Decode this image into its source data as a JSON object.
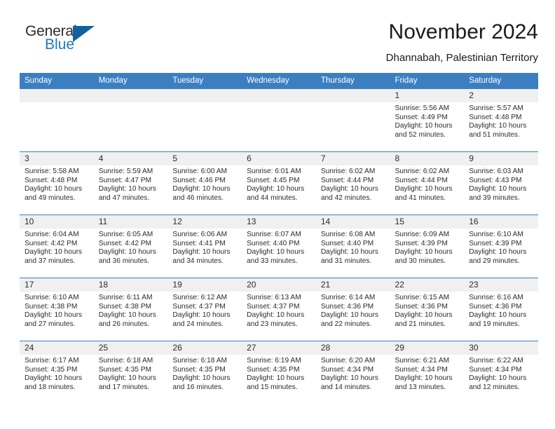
{
  "logo": {
    "word_one": "General",
    "word_two": "Blue",
    "icon": "triangle-logo-mark"
  },
  "header": {
    "month_title": "November 2024",
    "location": "Dhannabah, Palestinian Territory"
  },
  "calendar": {
    "weekday_headers": [
      "Sunday",
      "Monday",
      "Tuesday",
      "Wednesday",
      "Thursday",
      "Friday",
      "Saturday"
    ],
    "accent_color": "#3c7fc1",
    "daynum_band_color": "#f0f0f0",
    "weeks": [
      [
        {
          "day": "",
          "empty": true
        },
        {
          "day": "",
          "empty": true
        },
        {
          "day": "",
          "empty": true
        },
        {
          "day": "",
          "empty": true
        },
        {
          "day": "",
          "empty": true
        },
        {
          "day": "1",
          "sunrise": "Sunrise: 5:56 AM",
          "sunset": "Sunset: 4:49 PM",
          "daylight_line1": "Daylight: 10 hours",
          "daylight_line2": "and 52 minutes."
        },
        {
          "day": "2",
          "sunrise": "Sunrise: 5:57 AM",
          "sunset": "Sunset: 4:48 PM",
          "daylight_line1": "Daylight: 10 hours",
          "daylight_line2": "and 51 minutes."
        }
      ],
      [
        {
          "day": "3",
          "sunrise": "Sunrise: 5:58 AM",
          "sunset": "Sunset: 4:48 PM",
          "daylight_line1": "Daylight: 10 hours",
          "daylight_line2": "and 49 minutes."
        },
        {
          "day": "4",
          "sunrise": "Sunrise: 5:59 AM",
          "sunset": "Sunset: 4:47 PM",
          "daylight_line1": "Daylight: 10 hours",
          "daylight_line2": "and 47 minutes."
        },
        {
          "day": "5",
          "sunrise": "Sunrise: 6:00 AM",
          "sunset": "Sunset: 4:46 PM",
          "daylight_line1": "Daylight: 10 hours",
          "daylight_line2": "and 46 minutes."
        },
        {
          "day": "6",
          "sunrise": "Sunrise: 6:01 AM",
          "sunset": "Sunset: 4:45 PM",
          "daylight_line1": "Daylight: 10 hours",
          "daylight_line2": "and 44 minutes."
        },
        {
          "day": "7",
          "sunrise": "Sunrise: 6:02 AM",
          "sunset": "Sunset: 4:44 PM",
          "daylight_line1": "Daylight: 10 hours",
          "daylight_line2": "and 42 minutes."
        },
        {
          "day": "8",
          "sunrise": "Sunrise: 6:02 AM",
          "sunset": "Sunset: 4:44 PM",
          "daylight_line1": "Daylight: 10 hours",
          "daylight_line2": "and 41 minutes."
        },
        {
          "day": "9",
          "sunrise": "Sunrise: 6:03 AM",
          "sunset": "Sunset: 4:43 PM",
          "daylight_line1": "Daylight: 10 hours",
          "daylight_line2": "and 39 minutes."
        }
      ],
      [
        {
          "day": "10",
          "sunrise": "Sunrise: 6:04 AM",
          "sunset": "Sunset: 4:42 PM",
          "daylight_line1": "Daylight: 10 hours",
          "daylight_line2": "and 37 minutes."
        },
        {
          "day": "11",
          "sunrise": "Sunrise: 6:05 AM",
          "sunset": "Sunset: 4:42 PM",
          "daylight_line1": "Daylight: 10 hours",
          "daylight_line2": "and 36 minutes."
        },
        {
          "day": "12",
          "sunrise": "Sunrise: 6:06 AM",
          "sunset": "Sunset: 4:41 PM",
          "daylight_line1": "Daylight: 10 hours",
          "daylight_line2": "and 34 minutes."
        },
        {
          "day": "13",
          "sunrise": "Sunrise: 6:07 AM",
          "sunset": "Sunset: 4:40 PM",
          "daylight_line1": "Daylight: 10 hours",
          "daylight_line2": "and 33 minutes."
        },
        {
          "day": "14",
          "sunrise": "Sunrise: 6:08 AM",
          "sunset": "Sunset: 4:40 PM",
          "daylight_line1": "Daylight: 10 hours",
          "daylight_line2": "and 31 minutes."
        },
        {
          "day": "15",
          "sunrise": "Sunrise: 6:09 AM",
          "sunset": "Sunset: 4:39 PM",
          "daylight_line1": "Daylight: 10 hours",
          "daylight_line2": "and 30 minutes."
        },
        {
          "day": "16",
          "sunrise": "Sunrise: 6:10 AM",
          "sunset": "Sunset: 4:39 PM",
          "daylight_line1": "Daylight: 10 hours",
          "daylight_line2": "and 29 minutes."
        }
      ],
      [
        {
          "day": "17",
          "sunrise": "Sunrise: 6:10 AM",
          "sunset": "Sunset: 4:38 PM",
          "daylight_line1": "Daylight: 10 hours",
          "daylight_line2": "and 27 minutes."
        },
        {
          "day": "18",
          "sunrise": "Sunrise: 6:11 AM",
          "sunset": "Sunset: 4:38 PM",
          "daylight_line1": "Daylight: 10 hours",
          "daylight_line2": "and 26 minutes."
        },
        {
          "day": "19",
          "sunrise": "Sunrise: 6:12 AM",
          "sunset": "Sunset: 4:37 PM",
          "daylight_line1": "Daylight: 10 hours",
          "daylight_line2": "and 24 minutes."
        },
        {
          "day": "20",
          "sunrise": "Sunrise: 6:13 AM",
          "sunset": "Sunset: 4:37 PM",
          "daylight_line1": "Daylight: 10 hours",
          "daylight_line2": "and 23 minutes."
        },
        {
          "day": "21",
          "sunrise": "Sunrise: 6:14 AM",
          "sunset": "Sunset: 4:36 PM",
          "daylight_line1": "Daylight: 10 hours",
          "daylight_line2": "and 22 minutes."
        },
        {
          "day": "22",
          "sunrise": "Sunrise: 6:15 AM",
          "sunset": "Sunset: 4:36 PM",
          "daylight_line1": "Daylight: 10 hours",
          "daylight_line2": "and 21 minutes."
        },
        {
          "day": "23",
          "sunrise": "Sunrise: 6:16 AM",
          "sunset": "Sunset: 4:36 PM",
          "daylight_line1": "Daylight: 10 hours",
          "daylight_line2": "and 19 minutes."
        }
      ],
      [
        {
          "day": "24",
          "sunrise": "Sunrise: 6:17 AM",
          "sunset": "Sunset: 4:35 PM",
          "daylight_line1": "Daylight: 10 hours",
          "daylight_line2": "and 18 minutes."
        },
        {
          "day": "25",
          "sunrise": "Sunrise: 6:18 AM",
          "sunset": "Sunset: 4:35 PM",
          "daylight_line1": "Daylight: 10 hours",
          "daylight_line2": "and 17 minutes."
        },
        {
          "day": "26",
          "sunrise": "Sunrise: 6:18 AM",
          "sunset": "Sunset: 4:35 PM",
          "daylight_line1": "Daylight: 10 hours",
          "daylight_line2": "and 16 minutes."
        },
        {
          "day": "27",
          "sunrise": "Sunrise: 6:19 AM",
          "sunset": "Sunset: 4:35 PM",
          "daylight_line1": "Daylight: 10 hours",
          "daylight_line2": "and 15 minutes."
        },
        {
          "day": "28",
          "sunrise": "Sunrise: 6:20 AM",
          "sunset": "Sunset: 4:34 PM",
          "daylight_line1": "Daylight: 10 hours",
          "daylight_line2": "and 14 minutes."
        },
        {
          "day": "29",
          "sunrise": "Sunrise: 6:21 AM",
          "sunset": "Sunset: 4:34 PM",
          "daylight_line1": "Daylight: 10 hours",
          "daylight_line2": "and 13 minutes."
        },
        {
          "day": "30",
          "sunrise": "Sunrise: 6:22 AM",
          "sunset": "Sunset: 4:34 PM",
          "daylight_line1": "Daylight: 10 hours",
          "daylight_line2": "and 12 minutes."
        }
      ]
    ]
  }
}
